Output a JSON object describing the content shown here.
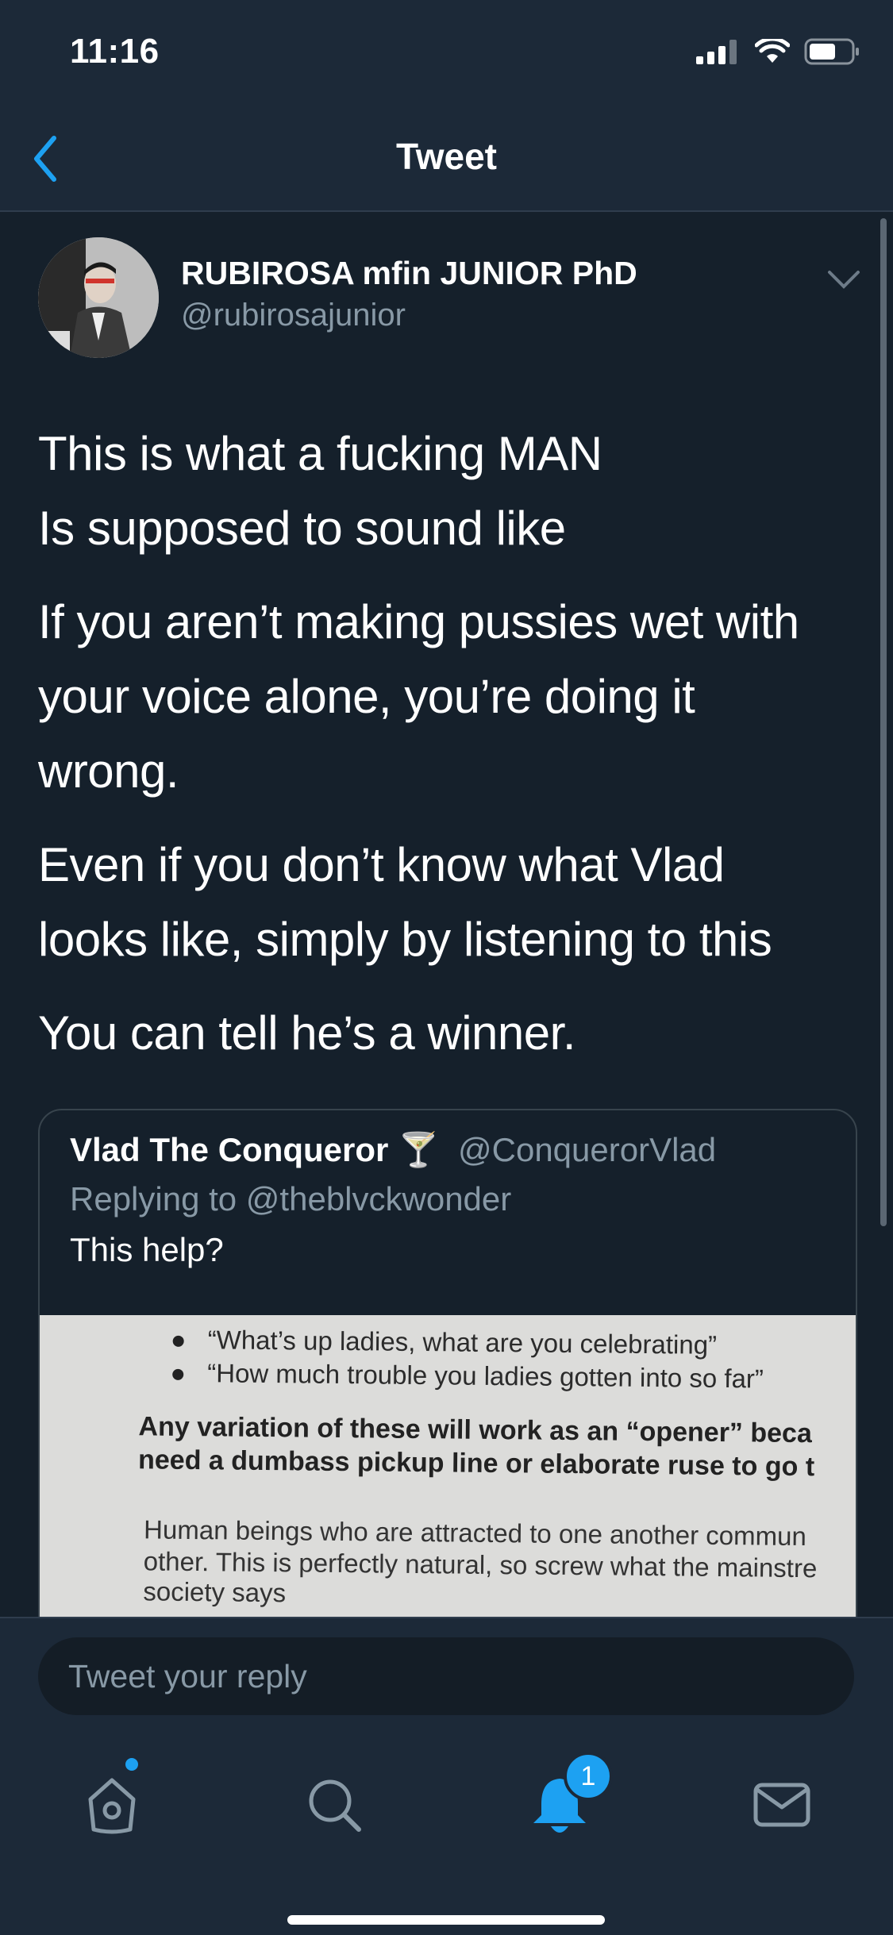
{
  "status_bar": {
    "time": "11:16"
  },
  "nav": {
    "title": "Tweet"
  },
  "tweet": {
    "author_name": "RUBIROSA mfin JUNIOR PhD",
    "author_handle": "@rubirosajunior",
    "paragraphs": [
      [
        "This is what a fucking MAN",
        "Is supposed to sound like"
      ],
      [
        "If you aren’t making pussies wet with",
        "your voice alone, you’re doing it",
        "wrong."
      ],
      [
        "Even if you don’t know what Vlad",
        "looks like, simply by listening to this"
      ],
      [
        "You can tell he’s a winner."
      ]
    ]
  },
  "quote": {
    "name": "Vlad The Conqueror 🍸",
    "handle": "@ConquerorVlad",
    "replying_to": "Replying to @theblvckwonder",
    "text": "This help?",
    "image_text": {
      "bullet1": "“What’s up ladies, what are you celebrating”",
      "bullet2": "“How much trouble you ladies gotten into so far”",
      "bold1": "Any variation of these will work as an “opener” beca",
      "bold2": "need a dumbass pickup line or elaborate ruse to go t",
      "body1": "Human beings who are attracted to one another commun",
      "body2": "other. This is perfectly natural, so screw what the mainstre",
      "body3": "society says"
    }
  },
  "reply": {
    "placeholder": "Tweet your reply"
  },
  "tabbar": {
    "notifications_badge": "1"
  },
  "colors": {
    "accent": "#1da1f2",
    "background": "#15202b",
    "bar": "#1c2938",
    "secondary_text": "#8899a6"
  }
}
